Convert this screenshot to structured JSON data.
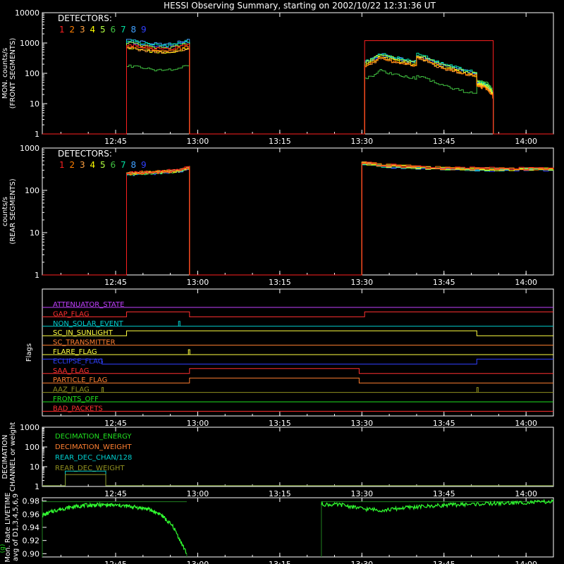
{
  "title": "HESSI Observing Summary, starting on 2002/10/22 12:31:36 UT",
  "time_axis": {
    "start_minutes": 751.6,
    "end_minutes": 845.0,
    "ticks": [
      {
        "t": 765,
        "label": "12:45"
      },
      {
        "t": 780,
        "label": "13:00"
      },
      {
        "t": 795,
        "label": "13:15"
      },
      {
        "t": 810,
        "label": "13:30"
      },
      {
        "t": 825,
        "label": "13:45"
      },
      {
        "t": 840,
        "label": "14:00"
      }
    ]
  },
  "detector_colors": [
    "#ff2020",
    "#ff7f00",
    "#ffa040",
    "#ffff00",
    "#b0ff40",
    "#40c040",
    "#00e0a0",
    "#40a0ff",
    "#3040ff"
  ],
  "chart_data": [
    {
      "type": "line",
      "id": "front",
      "ylabel": "MON. counts/s",
      "ylabel2": "(FRONT SEGMENTS)",
      "yscale": "log",
      "ylim": [
        1,
        10000
      ],
      "yticks": [
        "1",
        "10",
        "100",
        "1000",
        "10000"
      ],
      "legend_title": "DETECTORS:",
      "legend": [
        "1",
        "2",
        "3",
        "4",
        "5",
        "6",
        "7",
        "8",
        "9"
      ],
      "intervals": [
        {
          "start": 767.0,
          "end": 778.5,
          "levels": [
            900,
            800,
            700,
            700,
            1000,
            180,
            1200,
            1300,
            1100
          ],
          "shape": [
            1.0,
            0.95,
            0.85,
            0.8,
            0.75,
            0.72,
            0.7,
            0.72,
            0.8,
            0.9,
            1.0
          ]
        },
        {
          "start": 810.5,
          "end": 820.0,
          "levels": [
            200,
            180,
            180,
            200,
            240,
            70,
            260,
            250,
            230
          ],
          "shape": [
            1.0,
            1.1,
            1.4,
            1.8,
            1.6,
            1.4,
            1.3,
            1.2,
            1.1,
            1.0,
            1.0
          ]
        },
        {
          "start": 820.0,
          "end": 831.0,
          "levels": [
            350,
            320,
            300,
            330,
            380,
            80,
            420,
            400,
            360
          ],
          "shape": [
            1.0,
            0.9,
            0.75,
            0.6,
            0.5,
            0.45,
            0.4,
            0.35,
            0.3,
            0.28,
            0.25
          ]
        },
        {
          "start": 831.0,
          "end": 834.0,
          "levels": [
            40,
            38,
            40,
            45,
            50,
            60,
            55,
            50,
            48
          ],
          "shape": [
            1.0,
            1.0,
            0.95,
            0.9,
            0.9,
            0.85,
            0.8,
            0.7,
            0.6,
            0.5,
            0.4
          ]
        }
      ],
      "attenuated_detector_1": {
        "start": 810.5,
        "end": 834.0,
        "value": 1200
      }
    },
    {
      "type": "line",
      "id": "rear",
      "ylabel": "counts/s",
      "ylabel2": "(REAR SEGMENTS)",
      "yscale": "log",
      "ylim": [
        1,
        1000
      ],
      "yticks": [
        "1",
        "10",
        "100",
        "1000"
      ],
      "legend_title": "DETECTORS:",
      "legend": [
        "1",
        "2",
        "3",
        "4",
        "5",
        "6",
        "7",
        "8",
        "9"
      ],
      "intervals": [
        {
          "start": 767.0,
          "end": 778.5,
          "level": 260,
          "shape": [
            1.0,
            1.0,
            1.02,
            1.05,
            1.05,
            1.08,
            1.1,
            1.12,
            1.15,
            1.25,
            1.4
          ]
        },
        {
          "start": 810.0,
          "end": 845.0,
          "level": 380,
          "shape": [
            1.2,
            1.05,
            1.0,
            0.95,
            0.9,
            0.88,
            0.87,
            0.86,
            0.86,
            0.87,
            0.88
          ]
        }
      ]
    },
    {
      "type": "line",
      "id": "flags",
      "ylabel": "Flags",
      "flags": [
        {
          "name": "ATTENUATOR_STATE",
          "color": "#c040ff",
          "transitions": []
        },
        {
          "name": "GAP_FLAG",
          "color": "#ff3030",
          "transitions": [
            [
              767.0,
              1
            ],
            [
              778.5,
              0
            ],
            [
              810.5,
              1
            ]
          ]
        },
        {
          "name": "NON_SOLAR_EVENT",
          "color": "#00d0d0",
          "transitions": [],
          "spikes": [
            776.5
          ]
        },
        {
          "name": "SC_IN_SUNLIGHT",
          "color": "#ffff40",
          "transitions": [
            [
              767.0,
              1
            ],
            [
              831.0,
              0
            ]
          ]
        },
        {
          "name": "SC_TRANSMITTER",
          "color": "#ff7f30",
          "transitions": []
        },
        {
          "name": "FLARE_FLAG",
          "color": "#ffff40",
          "transitions": [],
          "spikes": [
            778.3
          ]
        },
        {
          "name": "ECLIPSE_FLAG",
          "color": "#3040ff",
          "transitions": [
            [
              762.5,
              0
            ],
            [
              831.0,
              1
            ]
          ],
          "initial": 1
        },
        {
          "name": "SAA_FLAG",
          "color": "#ff3030",
          "transitions": [
            [
              778.5,
              1
            ],
            [
              809.5,
              0
            ]
          ]
        },
        {
          "name": "PARTICLE_FLAG",
          "color": "#ff7f30",
          "transitions": [
            [
              778.5,
              1
            ],
            [
              809.5,
              0
            ]
          ]
        },
        {
          "name": "AAZ_FLAG",
          "color": "#909020",
          "transitions": [],
          "spikes": [
            762.5,
            831.0
          ]
        },
        {
          "name": "FRONTS_OFF",
          "color": "#20e020",
          "transitions": []
        },
        {
          "name": "BAD_PACKETS",
          "color": "#ff3030",
          "transitions": []
        }
      ]
    },
    {
      "type": "line",
      "id": "decimation",
      "ylabel": "DECIMATION",
      "ylabel2": "CHANNEL or weight",
      "yscale": "log",
      "ylim": [
        1,
        1000
      ],
      "yticks": [
        "1",
        "10",
        "100",
        "1000"
      ],
      "legend": [
        {
          "name": "DECIMATION_ENERGY",
          "color": "#20e020"
        },
        {
          "name": "DECIMATION_WEIGHT",
          "color": "#ff7f30"
        },
        {
          "name": "REAR_DEC_CHAN/128",
          "color": "#00d0d0"
        },
        {
          "name": "REAR_DEC_WEIGHT",
          "color": "#909020"
        }
      ],
      "boxes": [
        {
          "start": 755.8,
          "end": 763.2,
          "low": 1.1,
          "high": 6,
          "color": "#00d0d0"
        },
        {
          "start": 755.8,
          "end": 763.2,
          "low": 1.1,
          "high": 4,
          "color": "#909020"
        }
      ]
    },
    {
      "type": "line",
      "id": "livetime",
      "ylabel": "Mon. Rate LIVETIME",
      "ylabel2": "avg of D1,3,4,5,6,9",
      "ylim": [
        0.895,
        0.985
      ],
      "yticks": [
        "0.90",
        "0.92",
        "0.94",
        "0.96",
        "0.98"
      ],
      "segments": [
        {
          "start": 751.6,
          "end": 778.0,
          "profile": [
            0.958,
            0.966,
            0.97,
            0.973,
            0.974,
            0.974,
            0.973,
            0.971,
            0.968,
            0.96,
            0.94,
            0.9
          ]
        },
        {
          "start": 802.6,
          "end": 845.0,
          "profile": [
            0.975,
            0.974,
            0.968,
            0.966,
            0.97,
            0.972,
            0.974,
            0.975,
            0.976,
            0.977,
            0.978,
            0.979
          ]
        }
      ],
      "upper_envelope": 0.979
    }
  ]
}
